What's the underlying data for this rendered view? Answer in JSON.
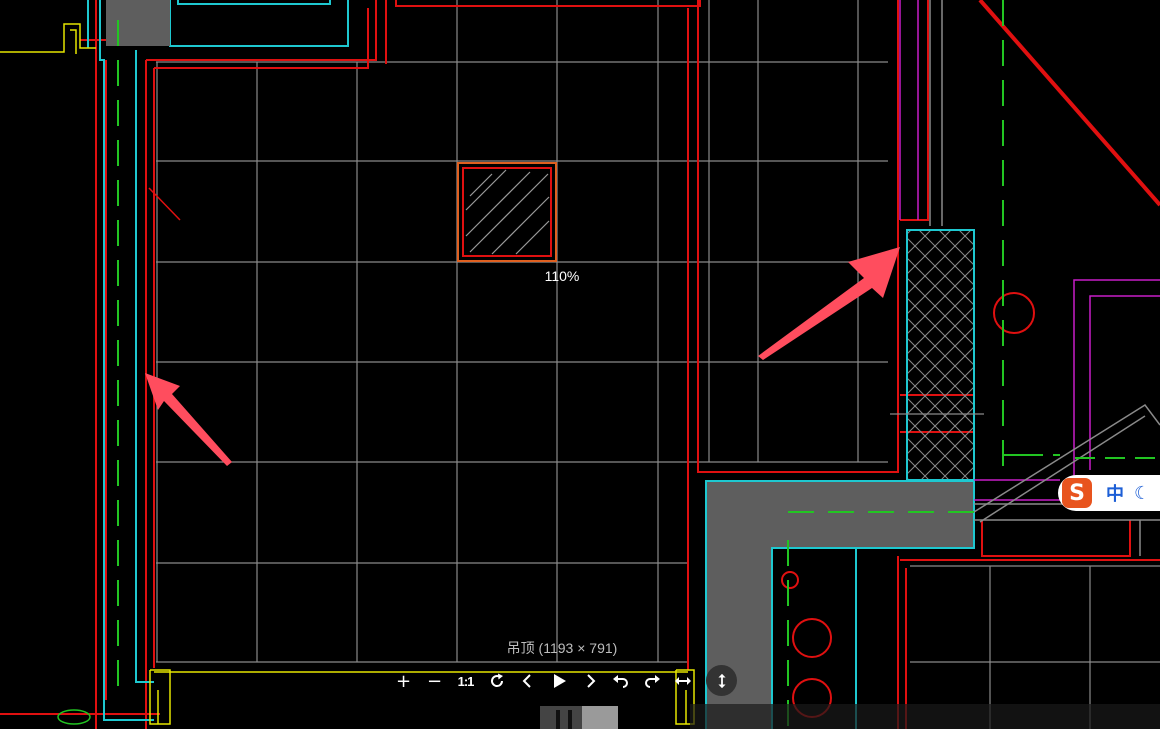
{
  "viewer": {
    "zoom_label": "110%",
    "image_caption": "吊顶 (1193 × 791)"
  },
  "toolbar": {
    "zoom_in": "+",
    "zoom_out": "−",
    "actual_size": "1:1"
  },
  "ime": {
    "logo": "S",
    "language": "中",
    "mode_icon": "moon-icon"
  },
  "colors": {
    "background": "#000000",
    "wall_red": "#e01010",
    "cyan": "#1ec8d0",
    "grid_gray": "#8a8a8a",
    "green_dash": "#22c522",
    "magenta": "#c81ec8",
    "yellow": "#e6e600",
    "arrow": "#ff4d5e",
    "ime_orange": "#e8541e",
    "ime_blue": "#1d5fd6"
  }
}
